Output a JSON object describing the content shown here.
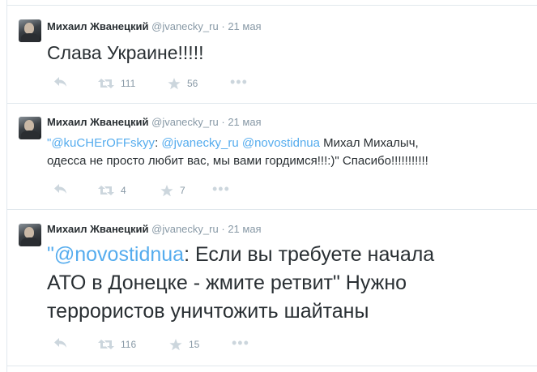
{
  "tweets": [
    {
      "fullname": "Михаил Жванецкий",
      "username": "@jvanecky_ru",
      "separator": "·",
      "time": "21 мая",
      "text": "Слава Украине!!!!!",
      "retweets": "111",
      "favorites": "56"
    },
    {
      "fullname": "Михаил Жванецкий",
      "username": "@jvanecky_ru",
      "separator": "·",
      "time": "21 мая",
      "quote_open": "\"",
      "mention1": "@kuCHErOFFskyy",
      "colon1": ": ",
      "mention2": "@jvanecky_ru",
      "space1": " ",
      "mention3": "@novostidnua",
      "text_line1_rest": " Михал Михалыч,",
      "text_line2": "одесса не просто любит вас, мы вами гордимся!!!:)\" Спасибо!!!!!!!!!!!",
      "retweets": "4",
      "favorites": "7"
    },
    {
      "fullname": "Михаил Жванецкий",
      "username": "@jvanecky_ru",
      "separator": "·",
      "time": "21 мая",
      "quote_open": "\"",
      "mention1": "@novostidnua",
      "text_line1_rest": ": Если вы требуете начала",
      "text_line2": "АТО в Донецке - жмите ретвит\" Нужно",
      "text_line3": "террористов уничтожить шайтаны",
      "retweets": "116",
      "favorites": "15"
    }
  ],
  "icons": {
    "reply": "reply-icon",
    "retweet": "retweet-icon",
    "favorite": "star-icon",
    "more": "more-icon"
  },
  "colors": {
    "link": "#55acee",
    "muted": "#8899a6",
    "icon": "#ccd6dd",
    "text": "#292f33",
    "border": "#e1e8ed"
  },
  "more_glyph": "•••"
}
